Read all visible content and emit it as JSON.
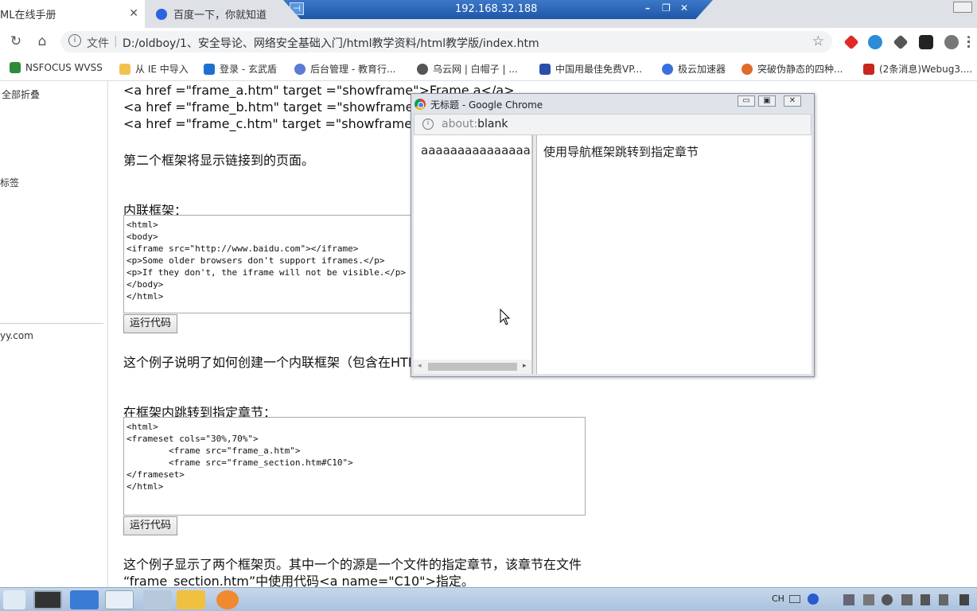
{
  "tabs": [
    {
      "title": "ML在线手册",
      "close": "✕"
    },
    {
      "title": "百度一下，你就知道",
      "close": "✕"
    }
  ],
  "remote_bar": {
    "ip": "192.168.32.188",
    "pin": "⊣",
    "minimize": "–",
    "restore": "❐",
    "close": "✕"
  },
  "toolbar": {
    "protocol_label": "文件",
    "separator": "|",
    "url": "D:/oldboy/1、安全导论、网络安全基础入门/html教学资料/html教学版/index.htm",
    "star": "☆",
    "reload": "↻",
    "home": "⌂"
  },
  "bookmarks": [
    {
      "label": "NSFOCUS WVSS",
      "color": "#2e8b3a"
    },
    {
      "label": "从 IE 中导入",
      "color": "#f2c14e"
    },
    {
      "label": "登录 - 玄武盾",
      "color": "#1f6fd1"
    },
    {
      "label": "后台管理 - 教育行...",
      "color": "#5b7bd5"
    },
    {
      "label": "乌云网 | 白帽子 | ...",
      "color": "#555555"
    },
    {
      "label": "中国用最佳免费VP...",
      "color": "#2a4fa8"
    },
    {
      "label": "极云加速器",
      "color": "#3a6fe0"
    },
    {
      "label": "突破伪静态的四种...",
      "color": "#e06a2a"
    },
    {
      "label": "(2条消息)Webug3....",
      "color": "#c8261e"
    }
  ],
  "sidebar": {
    "items": [
      "全部折叠",
      "标签",
      "yy.com"
    ]
  },
  "content": {
    "link_lines": [
      "<a href =\"frame_a.htm\" target =\"showframe\">Frame a</a>",
      "<a href =\"frame_b.htm\" target =\"showframe\">",
      "<a href =\"frame_c.htm\" target =\"showframe\">"
    ],
    "second_frame_text": "第二个框架将显示链接到的页面。",
    "inline_heading": "内联框架：",
    "inline_code": "<html>\n<body>\n<iframe src=\"http://www.baidu.com\"></iframe>\n<p>Some older browsers don't support iframes.</p>\n<p>If they don't, the iframe will not be visible.</p>\n</body>\n</html>",
    "run_label": "运行代码",
    "inline_desc": "这个例子说明了如何创建一个内联框架（包含在HTM",
    "jump_heading": "在框架内跳转到指定章节：",
    "jump_code": "<html>\n<frameset cols=\"30%,70%\">\n        <frame src=\"frame_a.htm\">\n        <frame src=\"frame_section.htm#C10\">\n</frameset>\n</html>",
    "run_label_2": "运行代码",
    "footer_line1": "这个例子显示了两个框架页。其中一个的源是一个文件的指定章节，该章节在文件",
    "footer_line2": "“frame_section.htm”中使用代码<a name=\"C10\">指定。"
  },
  "popup": {
    "title": "无标题 - Google Chrome",
    "address_proto": "about:",
    "address_rest": "blank",
    "left_text": "aaaaaaaaaaaaaaaaaaa",
    "right_text": "使用导航框架跳转到指定章节",
    "minimize": "▭",
    "restore": "▣",
    "close": "✕"
  },
  "taskbar": {
    "lang": "CH"
  }
}
